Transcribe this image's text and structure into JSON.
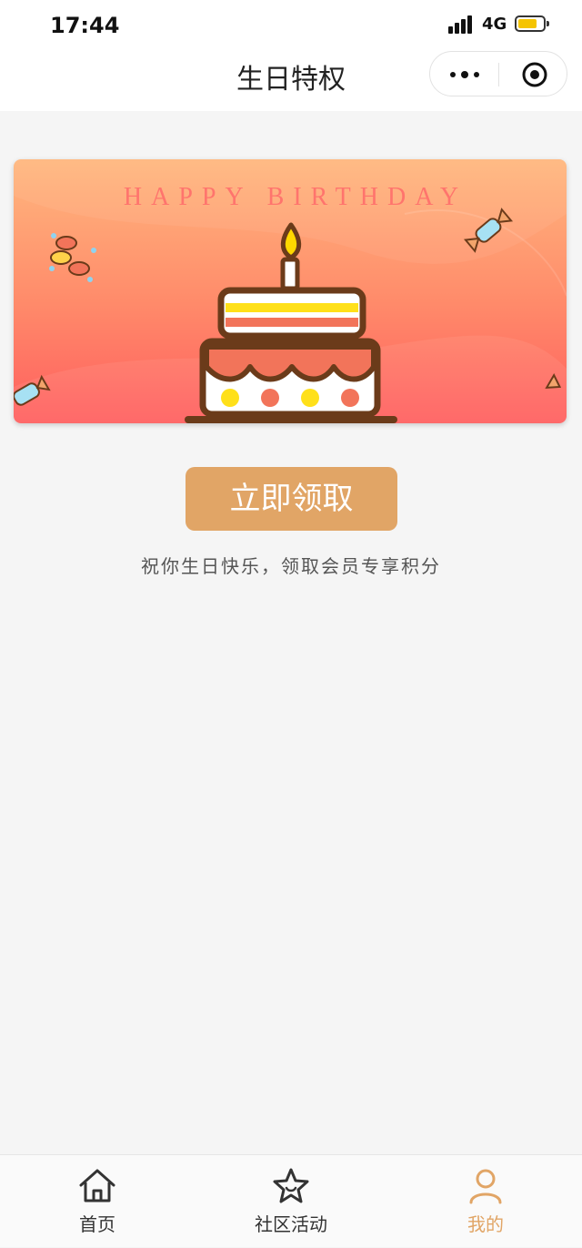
{
  "status_bar": {
    "time": "17:44",
    "network": "4G"
  },
  "nav": {
    "title": "生日特权"
  },
  "banner": {
    "text": "HAPPY BIRTHDAY"
  },
  "action": {
    "claim_label": "立即领取",
    "subtitle": "祝你生日快乐，领取会员专享积分"
  },
  "tabbar": {
    "items": [
      {
        "label": "首页",
        "icon": "home-icon"
      },
      {
        "label": "社区活动",
        "icon": "star-icon"
      },
      {
        "label": "我的",
        "icon": "user-icon",
        "active": true
      }
    ]
  },
  "colors": {
    "accent": "#e1a566",
    "banner_top": "#ffb77e",
    "banner_bottom": "#ff5e5e"
  }
}
